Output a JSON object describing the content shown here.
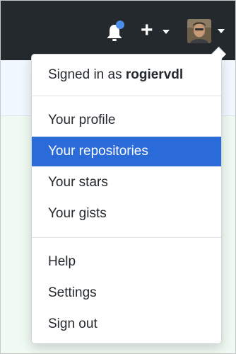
{
  "header": {
    "notification_icon": "bell-icon",
    "notification_badge_color": "#4a8ee8",
    "create_icon": "plus-icon",
    "create_symbol": "+",
    "avatar_icon": "avatar-photo"
  },
  "dropdown": {
    "signed_in_prefix": "Signed in as",
    "username": "rogiervdl",
    "items": [
      {
        "label": "Your profile",
        "active": false
      },
      {
        "label": "Your repositories",
        "active": true
      },
      {
        "label": "Your stars",
        "active": false
      },
      {
        "label": "Your gists",
        "active": false
      },
      {
        "label": "Help",
        "active": false
      },
      {
        "label": "Settings",
        "active": false
      },
      {
        "label": "Sign out",
        "active": false
      }
    ]
  },
  "colors": {
    "header_bg": "#24292e",
    "highlight": "#2b6ad9",
    "text": "#24292e"
  }
}
